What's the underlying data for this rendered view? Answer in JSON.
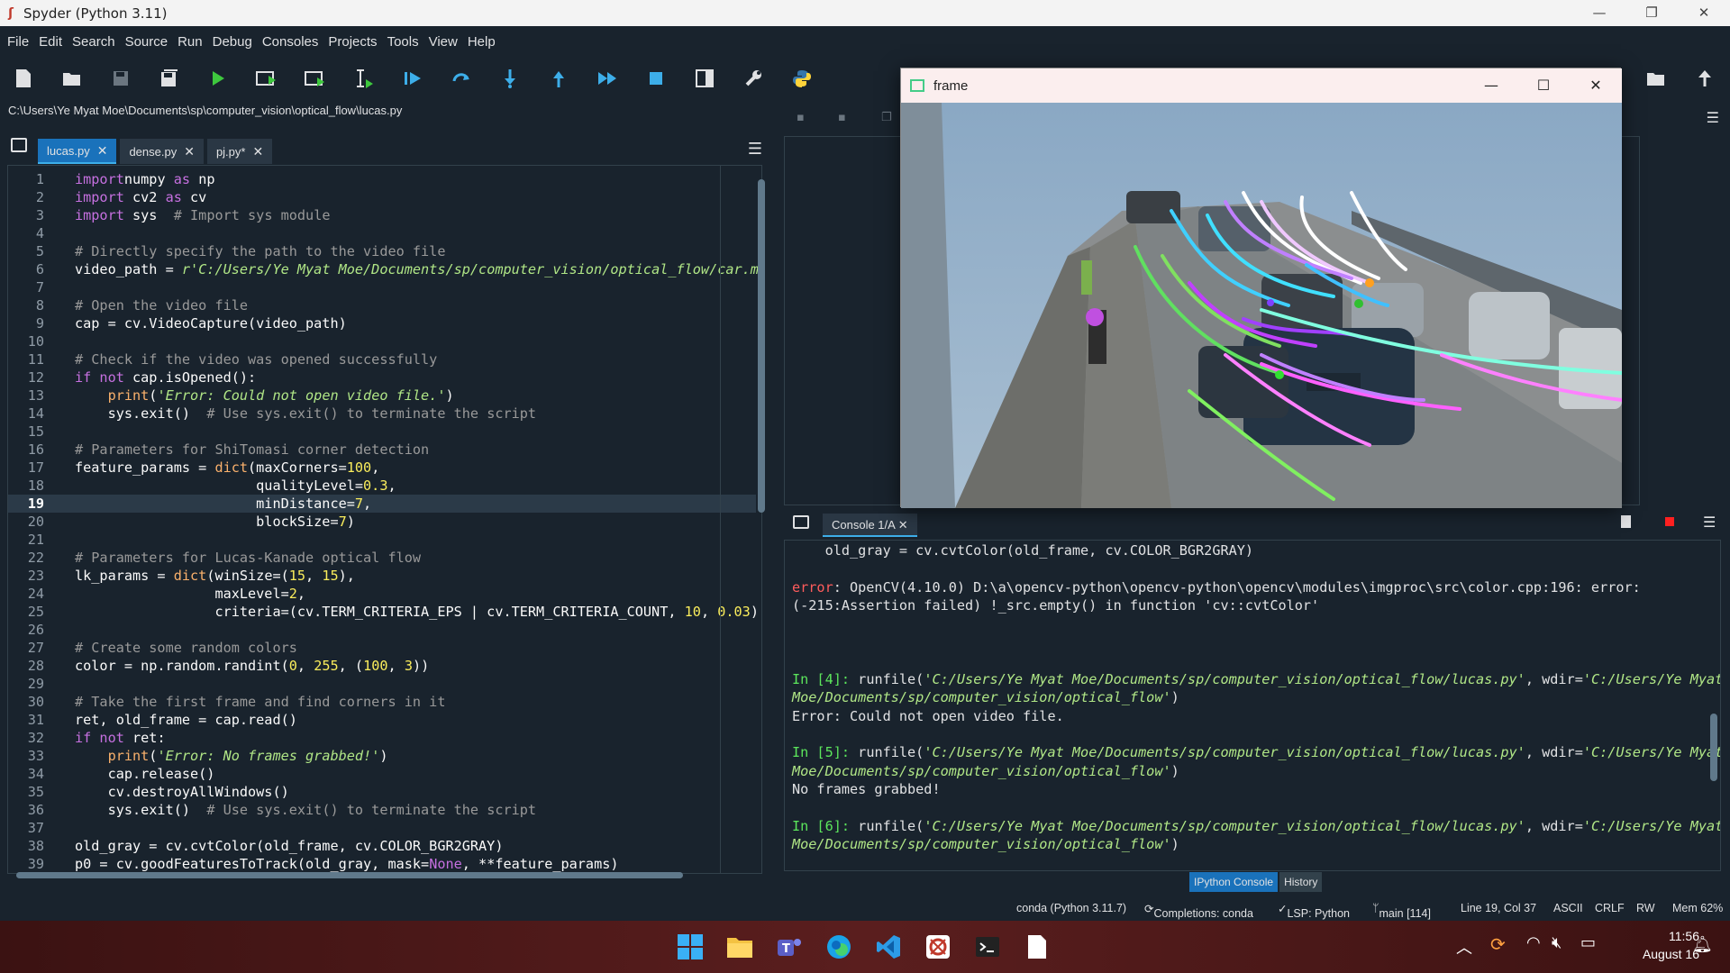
{
  "window": {
    "title": "Spyder (Python 3.11)",
    "minimize": "—",
    "maximize": "❐",
    "close": "✕"
  },
  "menu": [
    "File",
    "Edit",
    "Search",
    "Source",
    "Run",
    "Debug",
    "Consoles",
    "Projects",
    "Tools",
    "View",
    "Help"
  ],
  "path": "C:\\Users\\Ye Myat Moe\\Documents\\sp\\computer_vision\\optical_flow\\lucas.py",
  "editor": {
    "tabs": [
      {
        "label": "lucas.py",
        "active": true
      },
      {
        "label": "dense.py",
        "active": false
      },
      {
        "label": "pj.py*",
        "active": false
      }
    ],
    "current_line": 19
  },
  "console": {
    "tab_label": "Console 1/A",
    "bottom_tabs": [
      "IPython Console",
      "History"
    ]
  },
  "frame_window": {
    "title": "frame"
  },
  "status": {
    "env": "conda (Python 3.11.7)",
    "completions": "Completions: conda",
    "lsp": "LSP: Python",
    "git": "main [114]",
    "position": "Line 19, Col 37",
    "encoding": "ASCII",
    "eol": "CRLF",
    "rw": "RW",
    "mem": "Mem 62%"
  },
  "taskbar": {
    "time": "11:56",
    "date": "August 16"
  },
  "colors": {
    "accent": "#1a72bb",
    "bg": "#19232d",
    "taskbar": "#4d1a1a"
  }
}
